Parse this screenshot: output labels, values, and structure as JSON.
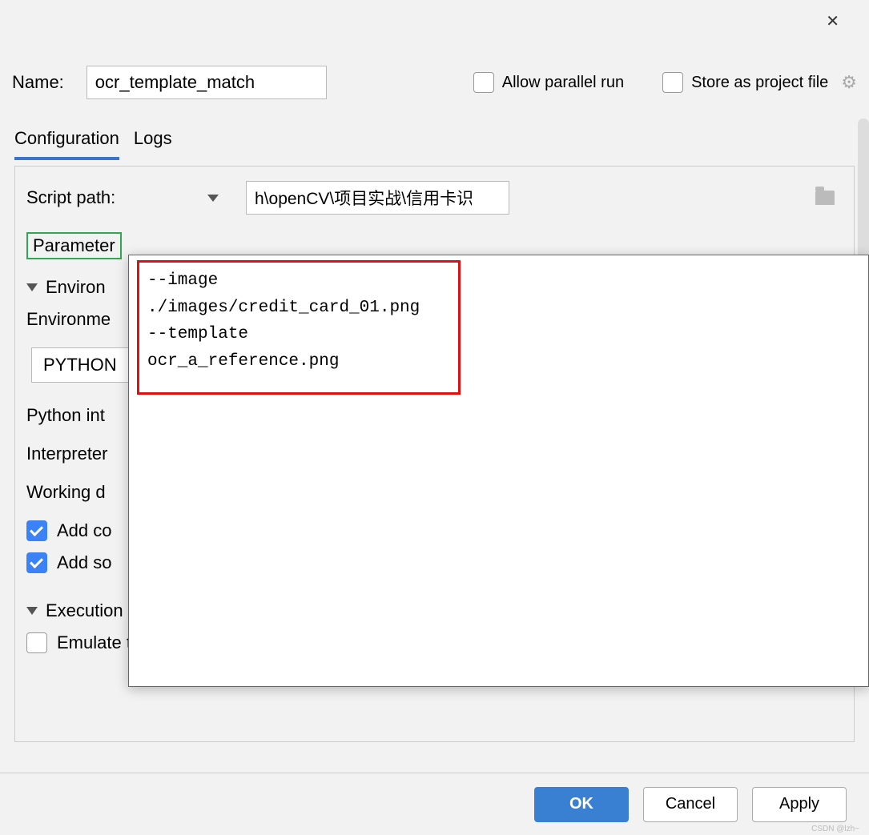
{
  "window": {
    "close_icon": "✕"
  },
  "header": {
    "name_label": "Name:",
    "name_value": "ocr_template_match",
    "allow_parallel_label": "Allow parallel run",
    "allow_parallel_checked": false,
    "store_project_label": "Store as project file",
    "store_project_checked": false
  },
  "tabs": {
    "configuration": "Configuration",
    "logs": "Logs",
    "active": "configuration"
  },
  "config": {
    "script_path_label": "Script path:",
    "script_path_value": "h\\openCV\\项目实战\\信用卡识别\\ocr_template_match.py",
    "parameters_label": "Parameter",
    "environment_section": "Environ",
    "env_vars_label": "Environme",
    "env_vars_value": "PYTHON",
    "python_interp_label": "Python int",
    "interp_options_label": "Interpreter",
    "working_dir_label": "Working d",
    "add_content_label": "Add co",
    "add_content_checked": true,
    "add_source_label": "Add so",
    "add_source_checked": true,
    "execution_section": "Execution",
    "emulate_terminal_label": "Emulate terminal in output console",
    "emulate_terminal_checked": false
  },
  "popup": {
    "parameters_text": "--image\n./images/credit_card_01.png\n--template\nocr_a_reference.png"
  },
  "footer": {
    "ok": "OK",
    "cancel": "Cancel",
    "apply": "Apply"
  },
  "watermark": "CSDN @lzh~"
}
